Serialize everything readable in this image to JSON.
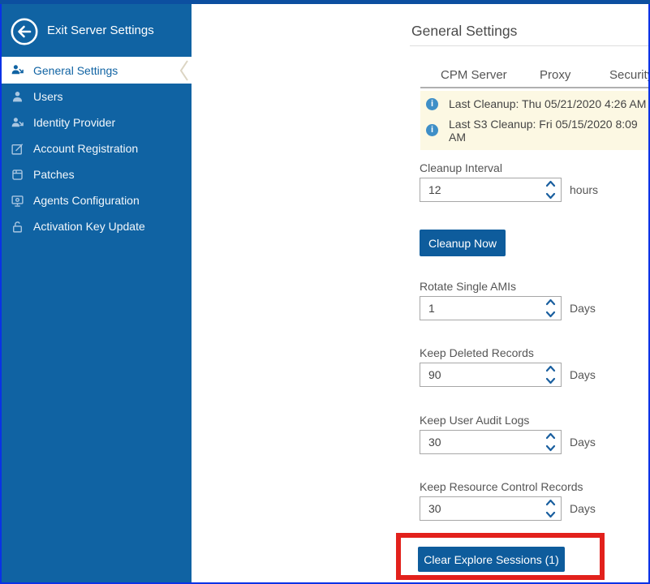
{
  "colors": {
    "sidebar_blue": "#1063A3",
    "top_strip_navy": "#0C4FA0",
    "frame_border_blue": "#0A32E6",
    "button_blue": "#0E5C9C",
    "notice_background": "#FCF8E3",
    "info_icon_blue": "#3F8FC7",
    "annotation_red": "#E2211C"
  },
  "sidebar": {
    "exit_label": "Exit Server Settings",
    "items": [
      {
        "label": "General Settings",
        "icon": "users-arrow-icon",
        "selected": true
      },
      {
        "label": "Users",
        "icon": "user-icon",
        "selected": false
      },
      {
        "label": "Identity Provider",
        "icon": "users-arrow-icon",
        "selected": false
      },
      {
        "label": "Account Registration",
        "icon": "edit-icon",
        "selected": false
      },
      {
        "label": "Patches",
        "icon": "package-icon",
        "selected": false
      },
      {
        "label": "Agents Configuration",
        "icon": "agent-monitor-icon",
        "selected": false
      },
      {
        "label": "Activation Key Update",
        "icon": "unlock-icon",
        "selected": false
      }
    ]
  },
  "main": {
    "title": "General Settings",
    "tabs": [
      {
        "label": "CPM Server"
      },
      {
        "label": "Proxy"
      },
      {
        "label": "Security"
      }
    ],
    "notice_icon_glyph": "i",
    "notices": [
      {
        "text": "Last Cleanup: Thu 05/21/2020 4:26 AM"
      },
      {
        "text": "Last S3 Cleanup: Fri 05/15/2020 8:09 AM"
      }
    ],
    "fields": [
      {
        "label": "Cleanup Interval",
        "value": "12",
        "unit": "hours"
      },
      {
        "label": "Rotate Single AMIs",
        "value": "1",
        "unit": "Days"
      },
      {
        "label": "Keep Deleted Records",
        "value": "90",
        "unit": "Days"
      },
      {
        "label": "Keep User Audit Logs",
        "value": "30",
        "unit": "Days"
      },
      {
        "label": "Keep Resource Control Records",
        "value": "30",
        "unit": "Days"
      }
    ],
    "buttons": {
      "cleanup_now": "Cleanup Now",
      "clear_explore_sessions": "Clear Explore Sessions (1)"
    }
  }
}
